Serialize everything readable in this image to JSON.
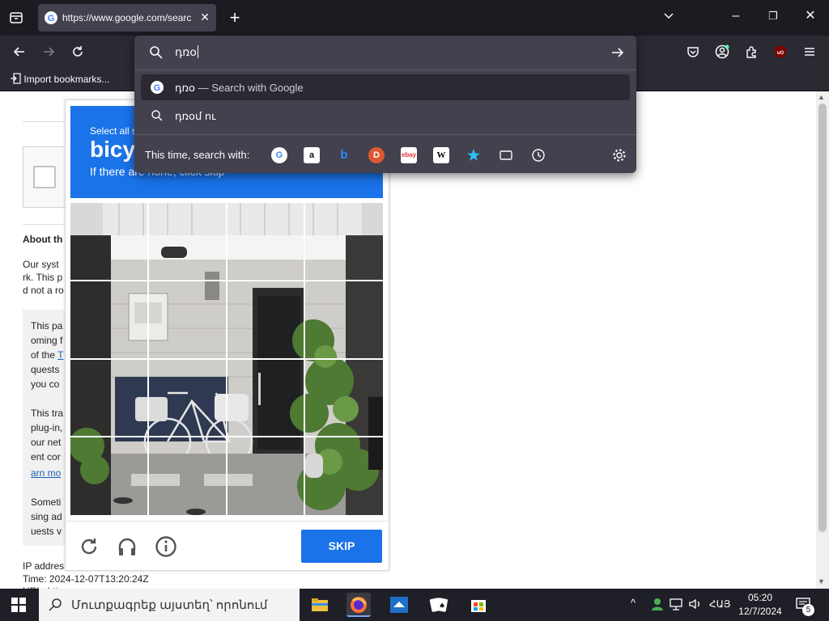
{
  "browser": {
    "tab": {
      "title": "https://www.google.com/searc",
      "close": "✕"
    },
    "tabbar_controls": {
      "list_all_tabs": "⌄",
      "minimize": "–",
      "restore": "❐",
      "close": "✕",
      "new_tab": "+"
    },
    "bookmarks_bar": {
      "import_label": "Import bookmarks..."
    }
  },
  "urlbar": {
    "value": "դռօ",
    "suggestions": [
      {
        "text": "դռօ",
        "suffix": " — Search with Google"
      },
      {
        "text": "դռօմ ու"
      }
    ],
    "one_off_label": "This time, search with:",
    "engines": [
      "Google",
      "Amazon",
      "Bing",
      "DuckDuckGo",
      "eBay",
      "Wikipedia",
      "Bookmarks",
      "Tabs",
      "History"
    ]
  },
  "captcha": {
    "instruction": "Select all s",
    "target": "bicy",
    "subtext": "If there are none, click skip",
    "skip_label": "SKIP"
  },
  "page": {
    "heading": "About th",
    "para1": [
      "Our syst",
      "rk. This p",
      "d not a ro"
    ],
    "box_para1": [
      "This pa",
      "oming f",
      "of the ",
      "quests",
      "you co"
    ],
    "box_link1": "T",
    "box_para2": [
      "This tra",
      "plug-in,",
      "our net",
      "ent cor"
    ],
    "box_link2": "arn mo",
    "box_para3": [
      "Someti",
      "sing ad",
      "uests v"
    ],
    "ip_label": "IP addres",
    "time_line": "Time: 2024-12-07T13:20:24Z",
    "url_line": "URL: htt"
  },
  "taskbar": {
    "search_placeholder": "Մուտքագրեք այստեղ՝ որոնում",
    "lang": "ՀԱՅ",
    "time": "05:20",
    "date": "12/7/2024",
    "notifications": "5"
  }
}
